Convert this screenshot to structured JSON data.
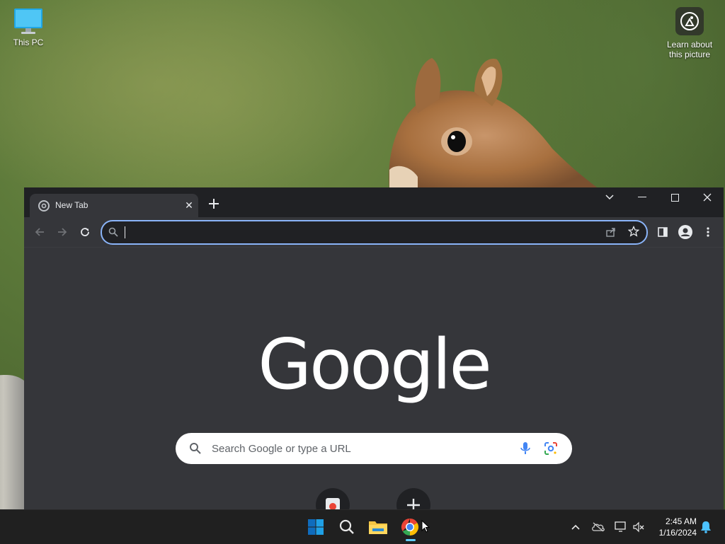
{
  "desktop": {
    "icons": [
      {
        "label": "This PC",
        "icon": "computer-monitor-icon"
      },
      {
        "label": "Learn about this picture",
        "icon": "camera-lens-icon"
      }
    ]
  },
  "browser": {
    "tab": {
      "title": "New Tab",
      "icon": "chrome-icon"
    },
    "window_controls": [
      "tab-search",
      "minimize",
      "maximize",
      "close"
    ],
    "omnibox": {
      "value": ""
    },
    "logo_text": "Google",
    "search_placeholder": "Search Google or type a URL",
    "accent_color": "#8ab4f8"
  },
  "taskbar": {
    "apps": [
      "start",
      "search",
      "file-explorer",
      "chrome"
    ],
    "active_app": "chrome",
    "time": "2:45 AM",
    "date": "1/16/2024"
  }
}
